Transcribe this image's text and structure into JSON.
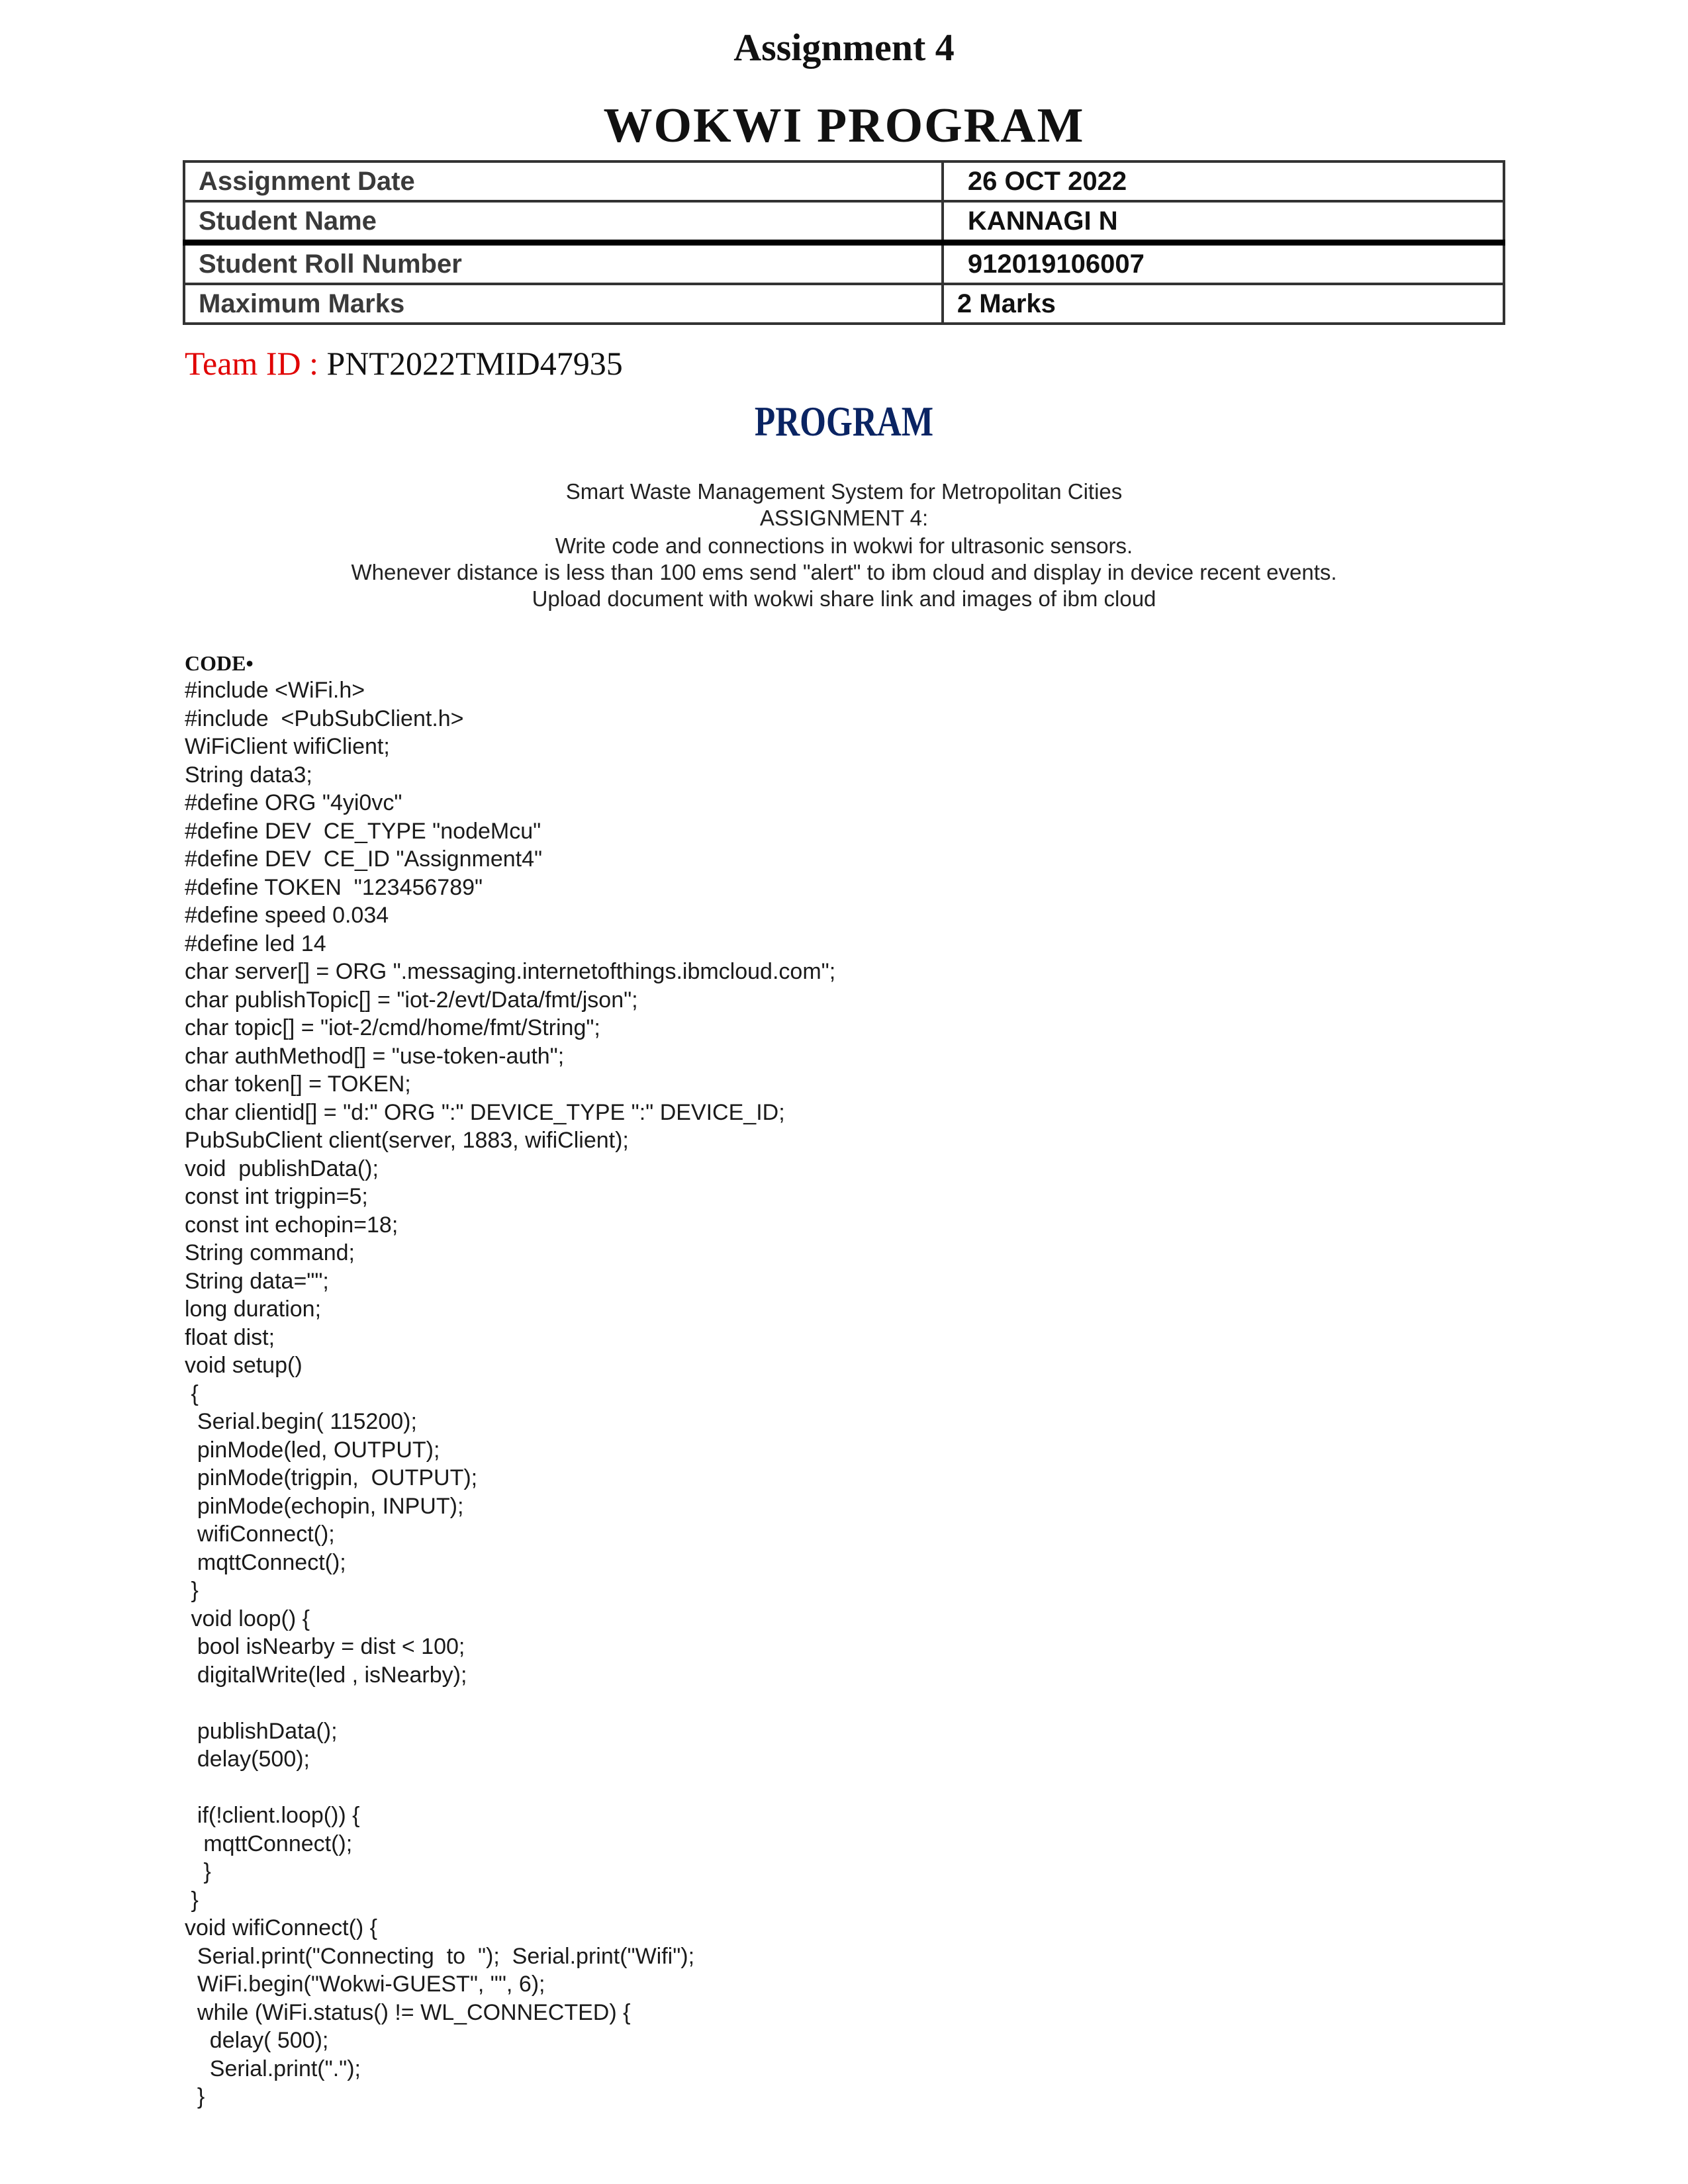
{
  "header": {
    "title": "Assignment 4",
    "subtitle": "WOKWI  PROGRAM"
  },
  "info_table": [
    {
      "label": "Assignment Date",
      "value": "26 OCT 2022"
    },
    {
      "label": "Student Name",
      "value": "KANNAGI N"
    },
    {
      "label": "Student Roll Number",
      "value": "912019106007"
    },
    {
      "label": "Maximum Marks",
      "value": "2 Marks"
    }
  ],
  "team": {
    "label": "Team ID  : ",
    "value": "PNT2022TMID47935"
  },
  "program_heading": "PROGRAM",
  "description": [
    "Smart Waste  Management  System for Metropolitan   Cities",
    "ASSIGNMENT 4:",
    "Write code  and  connections  in wokwi for  ultrasonic sensors.",
    "Whenever distance is less than 100 ems send \"alert\" to ibm cloud and  display in device recent events.",
    "Upload document with wokwi share link and images of ibm cloud"
  ],
  "code_label": "CODE•",
  "code_lines": [
    "#include <WiFi.h>",
    "#include  <PubSubClient.h>",
    "WiFiClient wifiClient;",
    "String data3;",
    "#define ORG \"4yi0vc\"",
    "#define DEV  CE_TYPE \"nodeMcu\"",
    "#define DEV  CE_ID \"Assignment4\"",
    "#define TOKEN  \"123456789\"",
    "#define speed 0.034",
    "#define led 14",
    "char server[] = ORG \".messaging.internetofthings.ibmcloud.com\";",
    "char publishTopic[] = \"iot-2/evt/Data/fmt/json\";",
    "char topic[] = \"iot-2/cmd/home/fmt/String\";",
    "char authMethod[] = \"use-token-auth\";",
    "char token[] = TOKEN;",
    "char clientid[] = \"d:\" ORG \":\" DEVICE_TYPE \":\" DEVICE_ID;",
    "PubSubClient client(server, 1883, wifiClient);",
    "void  publishData();",
    "const int trigpin=5;",
    "const int echopin=18;",
    "String command;",
    "String data=\"\";",
    "long duration;",
    "float dist;",
    "void setup()",
    " {",
    "  Serial.begin( 115200);",
    "  pinMode(led, OUTPUT);",
    "  pinMode(trigpin,  OUTPUT);",
    "  pinMode(echopin, INPUT);",
    "  wifiConnect();",
    "  mqttConnect();",
    " }",
    " void loop() {",
    "  bool isNearby = dist < 100;",
    "  digitalWrite(led , isNearby);",
    "",
    "  publishData();",
    "  delay(500);",
    "",
    "  if(!client.loop()) {",
    "   mqttConnect();",
    "   }",
    " }",
    "void wifiConnect() {",
    "  Serial.print(\"Connecting  to  \");  Serial.print(\"Wifi\");",
    "  WiFi.begin(\"Wokwi-GUEST\", \"\", 6);",
    "  while (WiFi.status() != WL_CONNECTED) {",
    "    delay( 500);",
    "    Serial.print(\".\");",
    "  }"
  ]
}
